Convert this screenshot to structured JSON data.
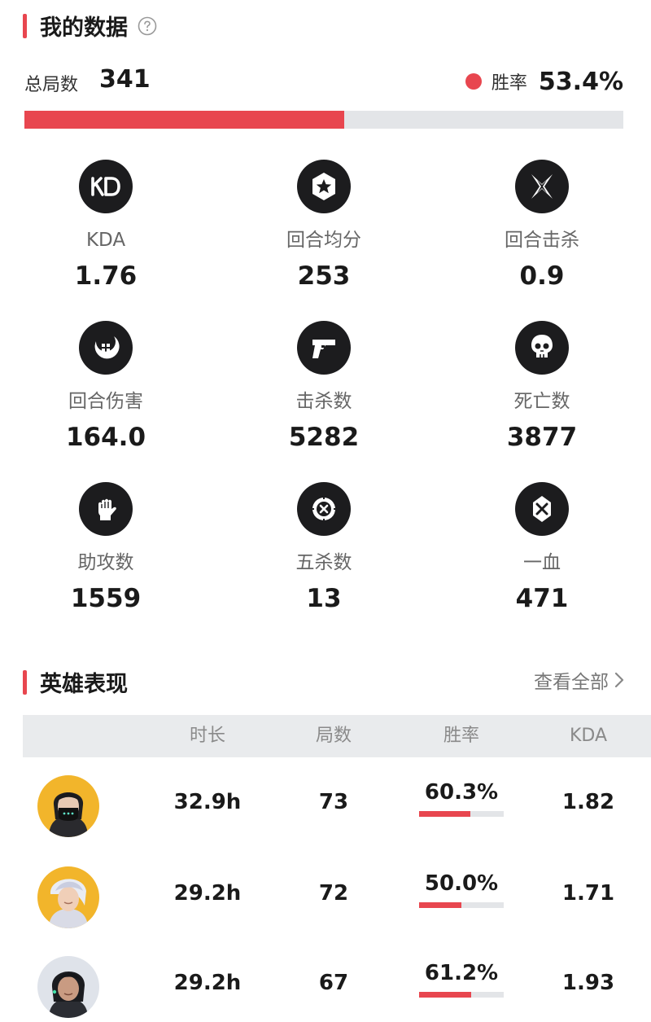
{
  "my_data": {
    "title": "我的数据",
    "total_label": "总局数",
    "total_value": "341",
    "winrate_label": "胜率",
    "winrate_value": "53.4%",
    "winrate_fraction": 0.534,
    "accent_color": "#e8464f"
  },
  "stats": [
    {
      "label": "KDA",
      "value": "1.76",
      "icon": "kd-icon"
    },
    {
      "label": "回合均分",
      "value": "253",
      "icon": "star-badge-icon"
    },
    {
      "label": "回合击杀",
      "value": "0.9",
      "icon": "crossed-blades-icon"
    },
    {
      "label": "回合伤害",
      "value": "164.0",
      "icon": "damage-crescent-icon"
    },
    {
      "label": "击杀数",
      "value": "5282",
      "icon": "pistol-icon"
    },
    {
      "label": "死亡数",
      "value": "3877",
      "icon": "skull-icon"
    },
    {
      "label": "助攻数",
      "value": "1559",
      "icon": "fist-icon"
    },
    {
      "label": "五杀数",
      "value": "13",
      "icon": "target-x-icon"
    },
    {
      "label": "一血",
      "value": "471",
      "icon": "blood-drop-x-icon"
    }
  ],
  "heroes": {
    "title": "英雄表现",
    "view_all": "查看全部",
    "columns": [
      "时长",
      "局数",
      "胜率",
      "KDA"
    ],
    "rows": [
      {
        "time": "32.9h",
        "games": "73",
        "winrate": "60.3%",
        "winrate_fraction": 0.603,
        "kda": "1.82"
      },
      {
        "time": "29.2h",
        "games": "72",
        "winrate": "50.0%",
        "winrate_fraction": 0.5,
        "kda": "1.71"
      },
      {
        "time": "29.2h",
        "games": "67",
        "winrate": "61.2%",
        "winrate_fraction": 0.612,
        "kda": "1.93"
      }
    ]
  }
}
